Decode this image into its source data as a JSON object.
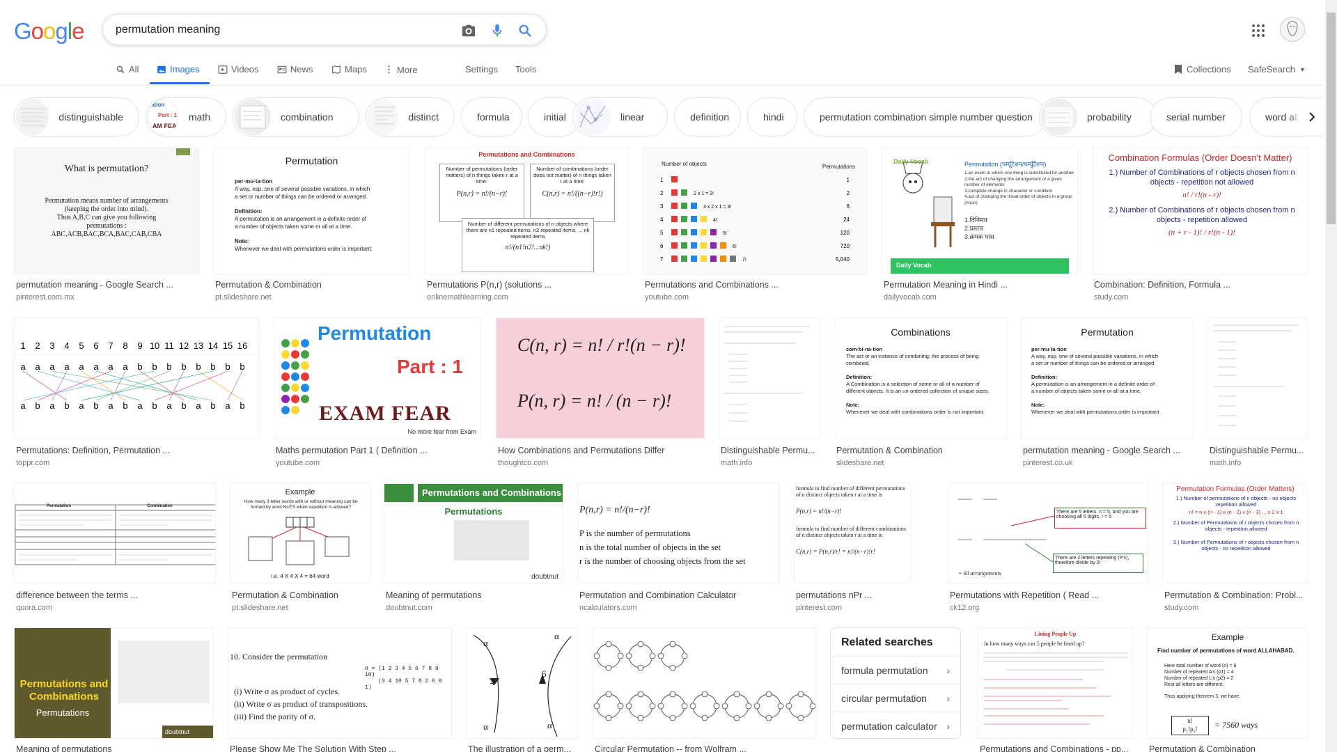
{
  "logo": [
    "G",
    "o",
    "o",
    "g",
    "l",
    "e"
  ],
  "search": {
    "query": "permutation meaning"
  },
  "nav": {
    "all": "All",
    "images": "Images",
    "videos": "Videos",
    "news": "News",
    "maps": "Maps",
    "more": "More",
    "settings": "Settings",
    "tools": "Tools",
    "collections": "Collections",
    "safesearch": "SafeSearch"
  },
  "chips": [
    "distinguishable",
    "math",
    "combination",
    "distinct",
    "formula",
    "initial",
    "linear",
    "definition",
    "hindi",
    "permutation combination simple number question",
    "probability",
    "serial number",
    "word abs"
  ],
  "chip_math_thumb": [
    "ation",
    "Part : 1",
    "AM FEA"
  ],
  "results": [
    {
      "title": "permutation meaning - Google Search ...",
      "source": "pinterest.com.mx"
    },
    {
      "title": "Permutation & Combination",
      "source": "pt.slideshare.net"
    },
    {
      "title": "Permutations P(n,r) (solutions ...",
      "source": "onlinemathlearning.com"
    },
    {
      "title": "Permutations and Combinations ...",
      "source": "youtube.com"
    },
    {
      "title": "Permutation Meaning in Hindi ...",
      "source": "dailyvocab.com"
    },
    {
      "title": "Combination: Definition, Formula ...",
      "source": "study.com"
    },
    {
      "title": "Permutations: Definition, Permutation ...",
      "source": "toppr.com"
    },
    {
      "title": "Maths permutation Part 1 ( Definition ...",
      "source": "youtube.com"
    },
    {
      "title": "How Combinations and Permutations Differ",
      "source": "thoughtco.com"
    },
    {
      "title": "Distinguishable Permu...",
      "source": "math.info"
    },
    {
      "title": "Permutation & Combination",
      "source": "slideshare.net"
    },
    {
      "title": "permutation meaning - Google Search ...",
      "source": "pinterest.co.uk"
    },
    {
      "title": "Distinguishable Permu...",
      "source": "math.info"
    },
    {
      "title": "difference between the terms ...",
      "source": "quora.com"
    },
    {
      "title": "Permutation & Combination",
      "source": "pt.slideshare.net"
    },
    {
      "title": "Meaning of permutations",
      "source": "doubtnut.com"
    },
    {
      "title": "Permutation and Combination Calculator",
      "source": "ncalculators.com"
    },
    {
      "title": "permutations nPr ...",
      "source": "pinterest.com"
    },
    {
      "title": "Permutations with Repetition ( Read ...",
      "source": "ck12.org"
    },
    {
      "title": "Permutation & Combination: Probl...",
      "source": "study.com"
    },
    {
      "title": "Meaning of permutations",
      "source": ""
    },
    {
      "title": "Please Show Me The Solution With Step ...",
      "source": ""
    },
    {
      "title": "The illustration of a perm...",
      "source": ""
    },
    {
      "title": "Circular Permutation -- from Wolfram ...",
      "source": ""
    },
    {
      "title": "Permutations and Combinations - pp...",
      "source": ""
    },
    {
      "title": "Permutation & Combination",
      "source": ""
    }
  ],
  "img_text": {
    "t1_head": "What is permutation?",
    "t1_body": [
      "Permutation means number of arrangements",
      "(keeping the order into mind).",
      "Thus A,B,C can give you following",
      "permutations :",
      "ABC,ACB,BAC,BCA,BAC,CAB,CBA"
    ],
    "t2_head": "Permutation",
    "t2_body": [
      "per·mu·ta·tion",
      "A way, esp. one of several possible variations, in which",
      "a set or number of things can be ordered or arranged.",
      "Definition:",
      "A permutation is an arrangement in a definite order of",
      "a number of objects taken some or all at a time.",
      "Note:",
      "Whenever we deal with permutations order is important."
    ],
    "t3_head": "Permutations and Combinations",
    "t3_boxes": [
      "Number of permutations (order matters) of n things taken r at a time:",
      "Number of combinations (order does not matter) of n things taken r at a time:",
      "Number of different permutations of n objects where there are n1 repeated items, n2 repeated items, ... nk repeated items"
    ],
    "t3_formulas": [
      "P(n,r) = n!/(n−r)!",
      "C(n,r) = n!/((n−r)!r!)",
      "n!/(n1!n2!...nk!)"
    ],
    "t4_head": [
      "Number of objects",
      "Permutations"
    ],
    "t4_rows": [
      [
        "1",
        "1",
        "1"
      ],
      [
        "2",
        "2 x 1 = 2!",
        "2"
      ],
      [
        "3",
        "3 x 2 x 1 = 3!",
        "6"
      ],
      [
        "4",
        "4!",
        "24"
      ],
      [
        "5",
        "5!",
        "120"
      ],
      [
        "6",
        "6!",
        "720"
      ],
      [
        "7",
        "7!",
        "5,040"
      ]
    ],
    "t5_head": "Permutation (पर्म्यूटेशन/पर्म्युटैशन)",
    "t5_body": [
      "1.an event in which one thing is substituted for another",
      "2.the act of changing the arrangement of a given number of elements",
      "3.complete change in character or condition",
      "4.act of changing the lineal order of objects in a group (noun)",
      "1.विनिमय",
      "2.प्रस्तार",
      "3.क्रमक पास"
    ],
    "t5_brand": "Daily Vocab",
    "t6_head": "Combination Formulas (Order Doesn't Matter)",
    "t6_body": [
      "1.) Number of Combinations of r objects chosen from n objects - repetition not allowed",
      "n! / r!(n - r)!",
      "2.) Number of Combinations of r objects chosen from n objects - repetition allowed",
      "(n + r - 1)! / r!(n - 1)!"
    ],
    "t7_numbers": [
      "1",
      "2",
      "3",
      "4",
      "5",
      "6",
      "7",
      "8",
      "9",
      "10",
      "11",
      "12",
      "13",
      "14",
      "15",
      "16"
    ],
    "t7_top": [
      "a",
      "a",
      "a",
      "a",
      "a",
      "a",
      "a",
      "a",
      "b",
      "b",
      "b",
      "b",
      "b",
      "b",
      "b",
      "b"
    ],
    "t7_bot": [
      "a",
      "b",
      "a",
      "b",
      "a",
      "b",
      "a",
      "b",
      "a",
      "b",
      "a",
      "b",
      "a",
      "b",
      "a",
      "b"
    ],
    "t8_head": "Permutation",
    "t8_part": "Part : 1",
    "t8_brand": "EXAM FEAR",
    "t8_tag": "No more fear from Exam",
    "t9_formulas": [
      "C(n, r) = n! / r!(n − r)!",
      "P(n, r) = n! / (n − r)!"
    ],
    "t11_head": "Combinations",
    "t11_body": [
      "com·bi·na·tion",
      "The act or an instance of combining; the process of being combined.",
      "Definition:",
      "A Combination is a selection of some or all of a number of different objects. It is an un-ordered collection of unique sizes.",
      "Note:",
      "Whenever we deal with combinations order is not important."
    ],
    "t14_headers": [
      "Permutation",
      "Combination"
    ],
    "t15_head": "Example",
    "t15_body": [
      "How many 3 letter words with or without meaning can be formed by word NUTS when repetition is allowed?",
      "i.e. 4 X 4 X 4  = 64 word"
    ],
    "t16_head": "Permutations and Combinations",
    "t16_sub": "Permutations",
    "t16_brand": "doubtnut",
    "t17_body": [
      "P(n,r) = n!/(n−r)!",
      "P is the number of permutations",
      "n is the total number of objects in the set",
      "r is the number of choosing objects from the set"
    ],
    "t18_body": [
      "formula to find number of different permutations of n distinct objects taken r at a time is",
      "P(n,r) = n!/(n−r)!",
      "formula to find number of different combinations of n distinct objects taken r at a time is",
      "C(n,r) = P(n,r)/r! = n!/(n−r)!r!"
    ],
    "t19_body": [
      "There are 5 letters, n = 5, and you are choosing all 5 digits, r = 5",
      "There are 2 letters repeating (P's), therefore divide by 2!",
      "= 60 arrangements"
    ],
    "t20_head": "Permutation Formulas (Order Matters)",
    "t20_body": [
      "1.) Number of permutations of n objects - no objects repetition allowed",
      "n! = n x (n - 1) x (n - 2) x (n - 3) ... x 2 x 1",
      "2.) Number of Permutations of r objects chosen from n objects - repetition allowed",
      "3.) Number of Permutations of r objects chosen from n objects - no repetition allowed"
    ],
    "t21_head": "Permutations and Combinations",
    "t21_sub": "Permutations",
    "t22_body": [
      "10.  Consider the permutation",
      "(i)  Write σ as product of cycles.",
      "(ii)  Write σ as product of transpositions.",
      "(iii)  Find the parity of σ."
    ],
    "t23_labels": [
      "α",
      "4",
      "6",
      "α",
      "α",
      "α"
    ],
    "t25_head": "Lining People Up",
    "t25_body": [
      "In how many ways can 5 people be lined up?"
    ],
    "t26_head": "Example",
    "t26_body": [
      "Find number of permutations of word ALLAHABAD.",
      "Here total number of word (n) = 9",
      "Number of repeated A's (p1) = 4",
      "Number of repeated L's (p2) = 2",
      "Rest all letters are different.",
      "Thus applying theorem 3, we have:",
      "= 7560 ways"
    ]
  },
  "related": {
    "heading": "Related searches",
    "items": [
      "formula permutation",
      "circular permutation",
      "permutation calculator"
    ]
  },
  "colors": {
    "blue": "#4285F4",
    "red": "#EA4335",
    "yellow": "#FBBC05",
    "green": "#34A853",
    "accent": "#1a73e8"
  }
}
